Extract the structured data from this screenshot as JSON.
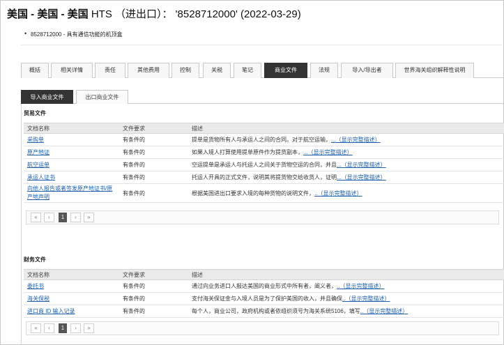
{
  "header": {
    "title_main": "美国 - 美国 - 美国",
    "title_hts": " HTS （进出口）： '8528712000'  (2022-03-29)"
  },
  "product": {
    "bullet": "8528712000 - 具有通信功能的机顶盒"
  },
  "tabs": [
    {
      "label": "概括"
    },
    {
      "label": "相关详情"
    },
    {
      "label": "责任"
    },
    {
      "label": "其他费用"
    },
    {
      "label": "控制"
    },
    {
      "label": "关税"
    },
    {
      "label": "笔记"
    },
    {
      "label": "商业文件"
    },
    {
      "label": "法规"
    },
    {
      "label": "导入/导出者"
    },
    {
      "label": "世界海关组织解释性说明"
    }
  ],
  "subtabs": [
    {
      "label": "导入商业文件"
    },
    {
      "label": "出口商业文件"
    }
  ],
  "sections": {
    "trade": {
      "title": "贸易文件",
      "headers": {
        "name": "文档名称",
        "req": "文件要求",
        "desc": "描述"
      },
      "rows": [
        {
          "name": "采购单",
          "req": "有条件的",
          "desc": "提单是货物所有人与承运人之间的合同。对于航空运输，",
          "more": "...（显示完整描述）"
        },
        {
          "name": "原产地证",
          "req": "有条件的",
          "desc": "如果入境人打算使用提单原件作为提货副本，",
          "more": "...（显示完整描述）"
        },
        {
          "name": "航空运单",
          "req": "有条件的",
          "desc": "空运提单是承运人与托运人之间关于货物空运的合同，并且",
          "more": "...（显示完整描述）"
        },
        {
          "name": "承运人证书",
          "req": "有条件的",
          "desc": "托运人开具的正式文件，说明其将提货物交给收货人，证明",
          "more": "...（显示完整描述）"
        },
        {
          "name": "向他人报告或者签发原产地证书/原产地声明",
          "req": "有条件的",
          "desc": "根据美国进出口要求入境的每种货物的说明文件，",
          "more": "..（显示完整描述）"
        }
      ]
    },
    "finance": {
      "title": "财务文件",
      "headers": {
        "name": "文档名称",
        "req": "文件要求",
        "desc": "描述"
      },
      "rows": [
        {
          "name": "委托书",
          "req": "有条件的",
          "desc": "通过向业务进口人报达美国的商业形式中所有者，阐义者，",
          "more": "..（显示完整描述）"
        },
        {
          "name": "海关保税",
          "req": "有条件的",
          "desc": "支付海关保证金与入境人员是为了保护美国的收入，并且确保",
          "more": "..（显示完整描述）"
        },
        {
          "name": "进口商 ID 输入记录",
          "req": "有条件的",
          "desc": "每个人，商业公司，政府机构或者依组织须号为海关系统5106，填写",
          "more": "..（显示完整描述）"
        }
      ]
    }
  },
  "pager": {
    "first": "«",
    "prev": "‹",
    "page": "1",
    "next": "›",
    "last": "»"
  }
}
